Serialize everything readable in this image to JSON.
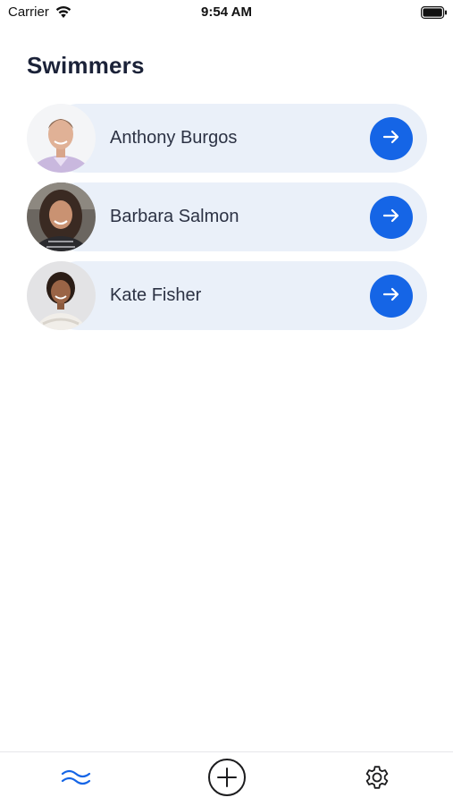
{
  "status_bar": {
    "carrier": "Carrier",
    "time": "9:54 AM"
  },
  "page": {
    "title": "Swimmers"
  },
  "swimmers": [
    {
      "name": "Anthony Burgos"
    },
    {
      "name": "Barbara Salmon"
    },
    {
      "name": "Kate Fisher"
    }
  ],
  "tab_bar": {
    "tabs": [
      {
        "icon": "waves-icon",
        "active": true
      },
      {
        "icon": "add-circle-icon",
        "active": false
      },
      {
        "icon": "gear-icon",
        "active": false
      }
    ]
  },
  "colors": {
    "accent": "#1565e6",
    "row_background": "#eaf0f9",
    "title": "#1b2238"
  }
}
